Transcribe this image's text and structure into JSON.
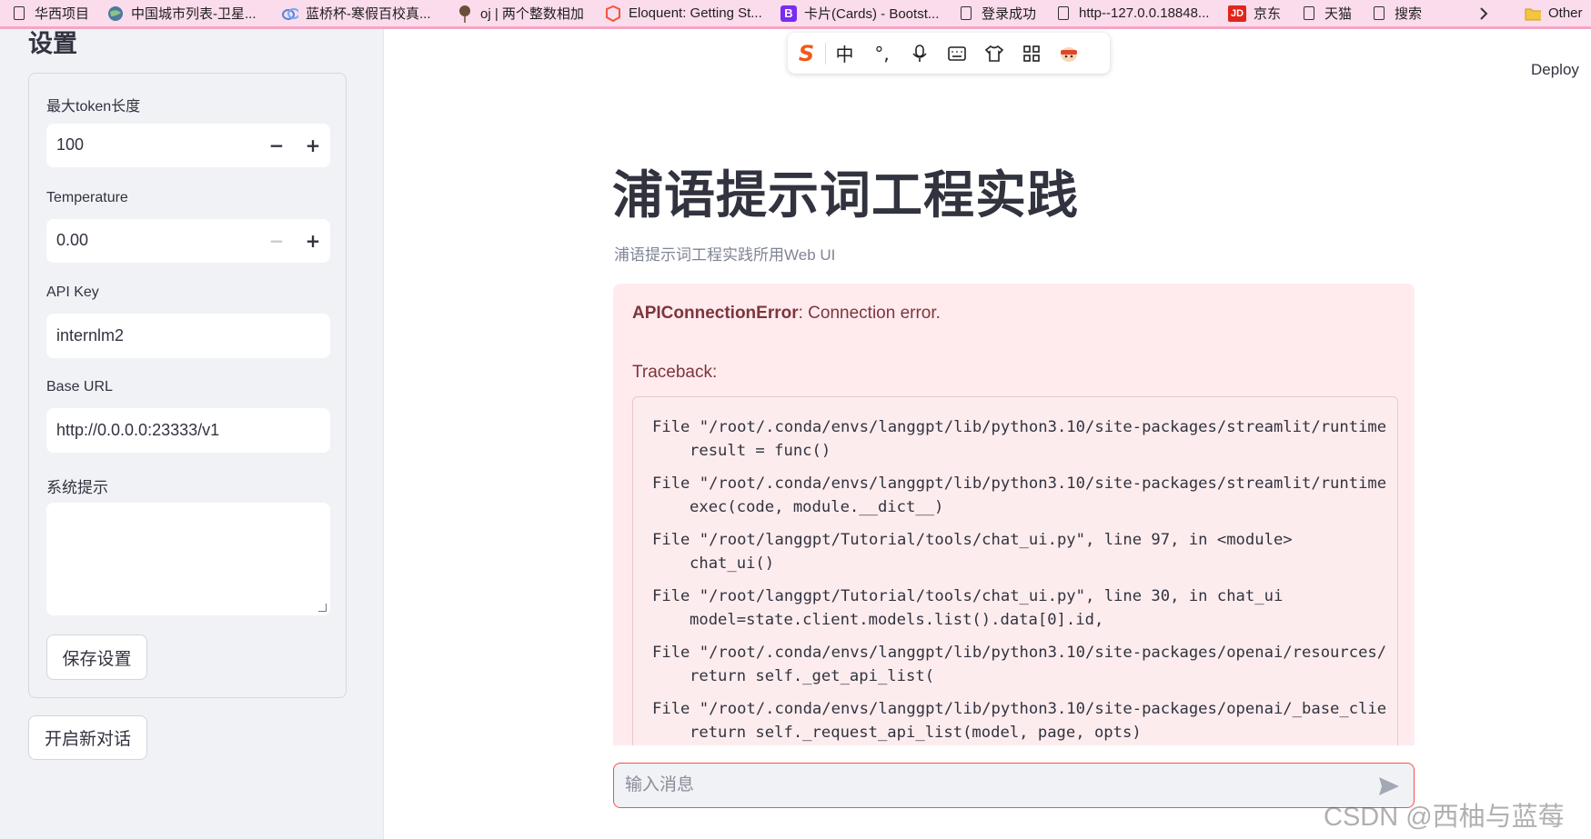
{
  "bookmarks": [
    {
      "label": "华西项目",
      "icon": "document-icon"
    },
    {
      "label": "中国城市列表-卫星...",
      "icon": "globe-icon"
    },
    {
      "label": "蓝桥杯-寒假百校真...",
      "icon": "cloud-icon"
    },
    {
      "label": "oj | 两个整数相加",
      "icon": "balloon-icon"
    },
    {
      "label": "Eloquent: Getting St...",
      "icon": "laravel-icon"
    },
    {
      "label": "卡片(Cards) - Bootst...",
      "icon": "bootstrap-icon"
    },
    {
      "label": "登录成功",
      "icon": "document-icon"
    },
    {
      "label": "http--127.0.0.18848...",
      "icon": "document-icon"
    },
    {
      "label": "京东",
      "icon": "jd-icon",
      "badge": "JD"
    },
    {
      "label": "天猫",
      "icon": "document-icon"
    },
    {
      "label": "搜索",
      "icon": "document-icon"
    },
    {
      "label": "Other",
      "icon": "folder-icon"
    }
  ],
  "ime_toolbar": {
    "lang": "中",
    "punct": "°,"
  },
  "sidebar": {
    "title": "设置",
    "max_tokens": {
      "label": "最大token长度",
      "value": "100"
    },
    "temperature": {
      "label": "Temperature",
      "value": "0.00"
    },
    "api_key": {
      "label": "API Key",
      "value": "internlm2"
    },
    "base_url": {
      "label": "Base URL",
      "value": "http://0.0.0.0:23333/v1"
    },
    "system_prompt": {
      "label": "系统提示",
      "value": ""
    },
    "save_button": "保存设置",
    "new_chat_button": "开启新对话"
  },
  "header": {
    "deploy": "Deploy"
  },
  "main": {
    "title": "浦语提示词工程实践",
    "subtitle": "浦语提示词工程实践所用Web UI",
    "error": {
      "type": "APIConnectionError",
      "message": ": Connection error.",
      "traceback_label": "Traceback:",
      "frames": [
        {
          "file": "File \"/root/.conda/envs/langgpt/lib/python3.10/site-packages/streamlit/runtime",
          "code": "result = func()"
        },
        {
          "file": "File \"/root/.conda/envs/langgpt/lib/python3.10/site-packages/streamlit/runtime",
          "code": "exec(code, module.__dict__)"
        },
        {
          "file": "File \"/root/langgpt/Tutorial/tools/chat_ui.py\", line 97, in <module>",
          "code": "chat_ui()"
        },
        {
          "file": "File \"/root/langgpt/Tutorial/tools/chat_ui.py\", line 30, in chat_ui",
          "code": "model=state.client.models.list().data[0].id,"
        },
        {
          "file": "File \"/root/.conda/envs/langgpt/lib/python3.10/site-packages/openai/resources/",
          "code": "return self._get_api_list("
        },
        {
          "file": "File \"/root/.conda/envs/langgpt/lib/python3.10/site-packages/openai/_base_clie",
          "code": "return self._request_api_list(model, page, opts)"
        }
      ]
    }
  },
  "chat_input": {
    "placeholder": "输入消息"
  },
  "watermark": "CSDN @西柚与蓝莓",
  "colors": {
    "accent": "#ff4b4b",
    "error_bg": "#ffebee",
    "sidebar_bg": "#f0f2f6",
    "bookmark_bar": "#fbdcec"
  }
}
